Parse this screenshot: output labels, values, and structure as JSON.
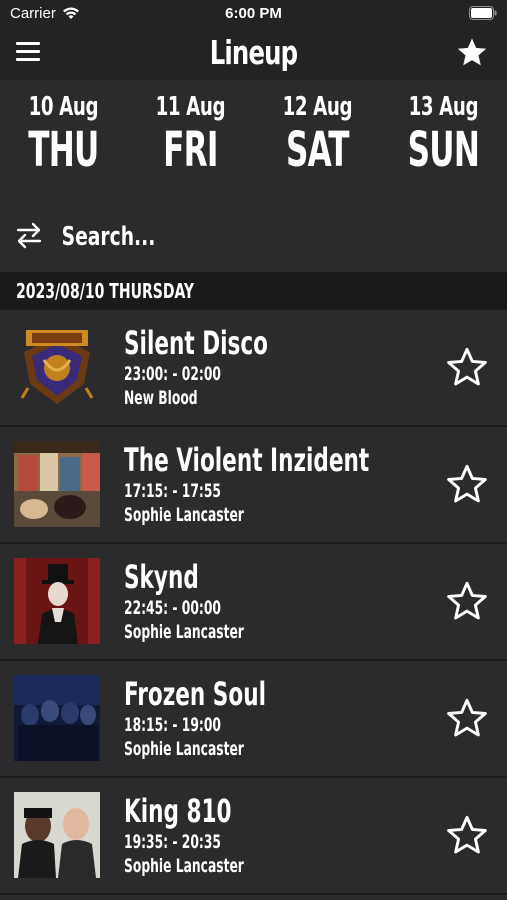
{
  "status": {
    "carrier": "Carrier",
    "time": "6:00 PM"
  },
  "nav": {
    "title": "Lineup"
  },
  "days": [
    {
      "date": "10 Aug",
      "name": "THU"
    },
    {
      "date": "11 Aug",
      "name": "FRI"
    },
    {
      "date": "12 Aug",
      "name": "SAT"
    },
    {
      "date": "13 Aug",
      "name": "SUN"
    }
  ],
  "search": {
    "placeholder": "Search..."
  },
  "section": {
    "header": "2023/08/10 THURSDAY"
  },
  "acts": [
    {
      "title": "Silent Disco",
      "time": "23:00: - 02:00",
      "stage": "New Blood",
      "thumb": "logo"
    },
    {
      "title": "The Violent Inzident",
      "time": "17:15: - 17:55",
      "stage": "Sophie Lancaster",
      "thumb": "band-photo"
    },
    {
      "title": "Skynd",
      "time": "22:45: - 00:00",
      "stage": "Sophie Lancaster",
      "thumb": "portrait"
    },
    {
      "title": "Frozen Soul",
      "time": "18:15: - 19:00",
      "stage": "Sophie Lancaster",
      "thumb": "band-photo"
    },
    {
      "title": "King 810",
      "time": "19:35: - 20:35",
      "stage": "Sophie Lancaster",
      "thumb": "band-photo"
    }
  ]
}
